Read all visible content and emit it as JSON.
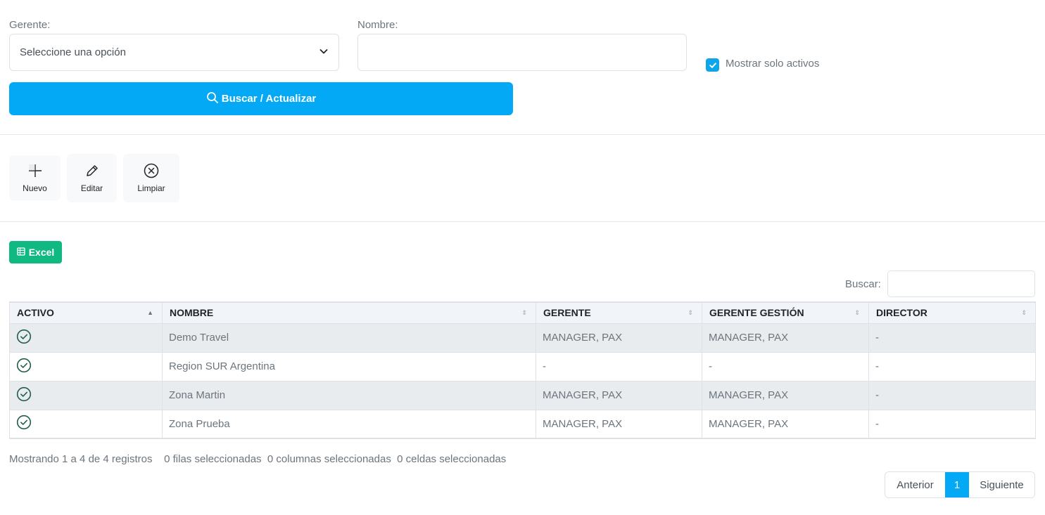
{
  "filters": {
    "gerente_label": "Gerente:",
    "gerente_value": "Seleccione una opción",
    "nombre_label": "Nombre:",
    "nombre_value": "",
    "activos_label": "Mostrar solo activos",
    "activos_checked": true,
    "search_button": "Buscar / Actualizar"
  },
  "toolbar": {
    "nuevo": "Nuevo",
    "editar": "Editar",
    "limpiar": "Limpiar"
  },
  "export": {
    "excel": "Excel"
  },
  "table_search": {
    "label": "Buscar:",
    "value": ""
  },
  "table": {
    "columns": [
      "ACTIVO",
      "NOMBRE",
      "GERENTE",
      "GERENTE GESTIÓN",
      "DIRECTOR"
    ],
    "rows": [
      {
        "activo": "check-circle-icon",
        "nombre": "Demo Travel",
        "gerente": "MANAGER, PAX",
        "gerente_gestion": "MANAGER, PAX",
        "director": "-"
      },
      {
        "activo": "check-circle-icon",
        "nombre": "Region SUR Argentina",
        "gerente": "-",
        "gerente_gestion": "-",
        "director": "-"
      },
      {
        "activo": "check-circle-icon",
        "nombre": "Zona Martin",
        "gerente": "MANAGER, PAX",
        "gerente_gestion": "MANAGER, PAX",
        "director": "-"
      },
      {
        "activo": "check-circle-icon",
        "nombre": "Zona Prueba",
        "gerente": "MANAGER, PAX",
        "gerente_gestion": "MANAGER, PAX",
        "director": "-"
      }
    ]
  },
  "footer": {
    "showing": "Mostrando 1 a 4 de 4 registros",
    "rows_selected": "0 filas seleccionadas",
    "cols_selected": "0 columnas seleccionadas",
    "cells_selected": "0 celdas seleccionadas"
  },
  "pagination": {
    "prev": "Anterior",
    "current": "1",
    "next": "Siguiente"
  },
  "colors": {
    "primary": "#03a9f4",
    "excel": "#10b981",
    "check": "#1f5f4a"
  }
}
